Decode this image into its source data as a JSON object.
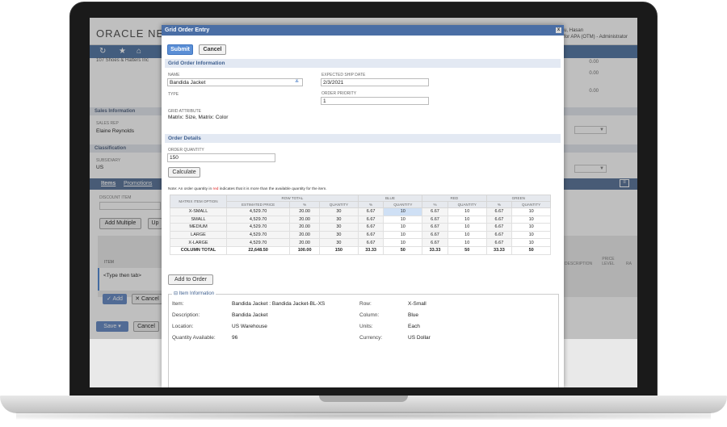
{
  "background": {
    "logo": "ORACLE NETS",
    "user_name": "glu, Hasan",
    "user_role": "y for APA (OTM) - Administrator",
    "customer": "107 Shoes & Hatters Inc",
    "sales_section": "Sales Information",
    "sales_rep_label": "SALES REP",
    "sales_rep": "Elaine Reynolds",
    "class_section": "Classification",
    "subsidiary_label": "SUBSIDIARY",
    "subsidiary": "US",
    "tab_items": "Items",
    "tab_promotions": "Promotions",
    "discount_label": "DISCOUNT ITEM",
    "add_multiple": "Add Multiple",
    "up_btn": "Up",
    "item_col": "ITEM",
    "type_then_tab": "<Type then tab>",
    "add_btn": "Add",
    "cancel_btn": "Cancel",
    "save_btn": "Save",
    "cancel_btn2": "Cancel",
    "right_values": [
      "0.00",
      "0.00",
      "0.00"
    ],
    "desc_col": "DESCRIPTION",
    "price_level_col": "PRICE LEVEL",
    "ra_col": "RA"
  },
  "modal": {
    "title": "Grid Order Entry",
    "close": "x",
    "submit": "Submit",
    "cancel": "Cancel",
    "grid_info_section": "Grid Order Information",
    "name_label": "NAME",
    "name_value": "Bandida Jacket",
    "type_label": "TYPE",
    "grid_attr_label": "GRID ATTRIBUTE",
    "grid_attr_value": "Matrix: Size, Matrix: Color",
    "ship_label": "EXPECTED SHIP DATE",
    "ship_value": "2/3/2021",
    "priority_label": "ORDER PRIORITY",
    "priority_value": "1",
    "order_details_section": "Order Details",
    "order_qty_label": "ORDER QUANTITY",
    "order_qty_value": "150",
    "calculate": "Calculate",
    "note_prefix": "Note: An order quantity in ",
    "note_red": "red",
    "note_suffix": " indicates that it is more than the available quantity for the item.",
    "add_to_order": "Add to Order"
  },
  "grid": {
    "headers": {
      "matrix_option": "MATRIX ITEM OPTION",
      "row_total": "ROW TOTAL",
      "blue": "BLUE",
      "red": "RED",
      "green": "GREEN",
      "est_price": "ESTIMATED PRICE",
      "pct": "%",
      "quantity": "QUANTITY"
    },
    "rows": [
      {
        "option": "X-SMALL",
        "price": "4,529.70",
        "pct": "20.00",
        "qty": "30",
        "b_pct": "6.67",
        "b_qty": "10",
        "r_pct": "6.67",
        "r_qty": "10",
        "g_pct": "6.67",
        "g_qty": "10"
      },
      {
        "option": "SMALL",
        "price": "4,529.70",
        "pct": "20.00",
        "qty": "30",
        "b_pct": "6.67",
        "b_qty": "10",
        "r_pct": "6.67",
        "r_qty": "10",
        "g_pct": "6.67",
        "g_qty": "10"
      },
      {
        "option": "MEDIUM",
        "price": "4,529.70",
        "pct": "20.00",
        "qty": "30",
        "b_pct": "6.67",
        "b_qty": "10",
        "r_pct": "6.67",
        "r_qty": "10",
        "g_pct": "6.67",
        "g_qty": "10"
      },
      {
        "option": "LARGE",
        "price": "4,529.70",
        "pct": "20.00",
        "qty": "30",
        "b_pct": "6.67",
        "b_qty": "10",
        "r_pct": "6.67",
        "r_qty": "10",
        "g_pct": "6.67",
        "g_qty": "10"
      },
      {
        "option": "X-LARGE",
        "price": "4,529.70",
        "pct": "20.00",
        "qty": "30",
        "b_pct": "6.67",
        "b_qty": "10",
        "r_pct": "6.67",
        "r_qty": "10",
        "g_pct": "6.67",
        "g_qty": "10"
      }
    ],
    "total": {
      "option": "COLUMN TOTAL",
      "price": "22,648.50",
      "pct": "100.00",
      "qty": "150",
      "b_pct": "33.33",
      "b_qty": "50",
      "r_pct": "33.33",
      "r_qty": "50",
      "g_pct": "33.33",
      "g_qty": "50"
    }
  },
  "item_info": {
    "legend": "Item Information",
    "item_label": "Item:",
    "item_value": "Bandida Jacket : Bandida Jacket-BL-XS",
    "desc_label": "Description:",
    "desc_value": "Bandida Jacket",
    "loc_label": "Location:",
    "loc_value": "US Warehouse",
    "qa_label": "Quantity Available:",
    "qa_value": "96",
    "row_label": "Row:",
    "row_value": "X-Small",
    "col_label": "Column:",
    "col_value": "Blue",
    "units_label": "Units:",
    "units_value": "Each",
    "currency_label": "Currency:",
    "currency_value": "US Dollar"
  },
  "colors": {
    "nav_blue": "#5a7ca8",
    "title_blue": "#4a6ea5",
    "button_blue": "#5b8fd6",
    "error_red": "#d22222"
  }
}
